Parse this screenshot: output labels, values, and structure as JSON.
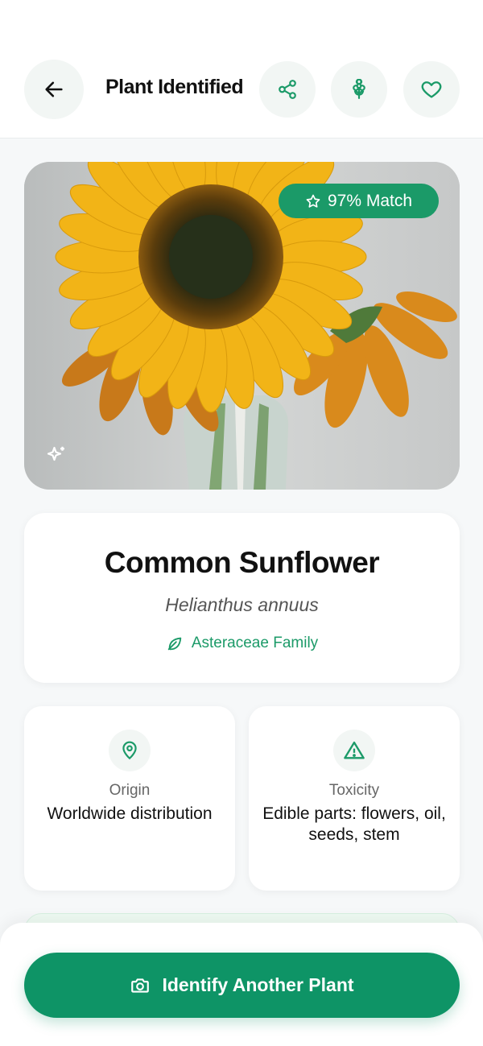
{
  "header": {
    "title": "Plant Identified",
    "back_icon": "arrow-left-icon",
    "actions": [
      {
        "icon": "share-icon"
      },
      {
        "icon": "flower-icon"
      },
      {
        "icon": "heart-icon"
      }
    ]
  },
  "photo": {
    "subject": "sunflower in glass vase",
    "match_label": "97% Match",
    "match_icon": "star-icon",
    "corner_icon": "sparkles-icon"
  },
  "plant": {
    "common_name": "Common Sunflower",
    "scientific_name": "Helianthus annuus",
    "family": "Asteraceae Family",
    "family_icon": "leaf-icon"
  },
  "info": {
    "origin": {
      "label": "Origin",
      "value": "Worldwide distribution",
      "icon": "map-pin-icon"
    },
    "toxicity": {
      "label": "Toxicity",
      "value": "Edible parts: flowers, oil, seeds, stem",
      "icon": "warning-triangle-icon"
    }
  },
  "cta": {
    "label": "Identify Another Plant",
    "icon": "camera-icon"
  },
  "colors": {
    "accent": "#1b9a68",
    "button": "#0e9466",
    "background": "#f6f8f9"
  }
}
